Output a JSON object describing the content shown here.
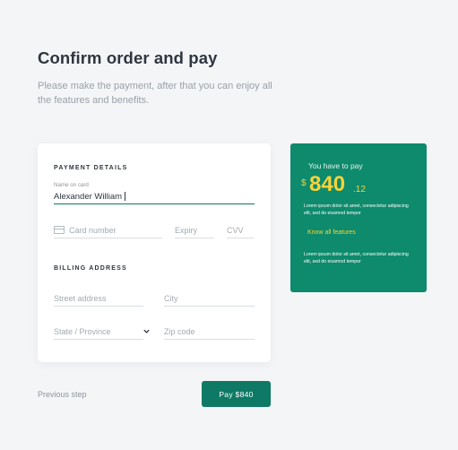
{
  "page": {
    "title": "Confirm order and pay",
    "subtitle": "Please make the payment, after that you can enjoy all the features and benefits."
  },
  "payment": {
    "section_label": "PAYMENT DETAILS",
    "name_label": "Name on card",
    "name_value": "Alexander William",
    "card_number_placeholder": "Card number",
    "expiry_placeholder": "Expiry",
    "cvv_placeholder": "CVV"
  },
  "billing": {
    "section_label": "BILLING ADDRESS",
    "street_placeholder": "Street address",
    "city_placeholder": "City",
    "state_placeholder": "State / Province",
    "zip_placeholder": "Zip code"
  },
  "actions": {
    "previous_label": "Previous step",
    "pay_label": "Pay $840"
  },
  "summary": {
    "heading": "You have to pay",
    "currency": "$",
    "amount_int": "840",
    "amount_dec": ".12",
    "lorem_1": "Lorem ipsum dolor sit amet, consectetur adipiscing elit, sed do eiusmod tempor",
    "link_label": "Know all features",
    "lorem_2": "Lorem ipsum dolor sit amet, consectetur adipiscing elit, sed do eiusmod tempor"
  },
  "colors": {
    "accent": "#0e7a65",
    "panel": "#0e8a6c",
    "highlight": "#f6d33a"
  },
  "icons": [
    "credit-card-icon",
    "chevron-down-icon"
  ]
}
